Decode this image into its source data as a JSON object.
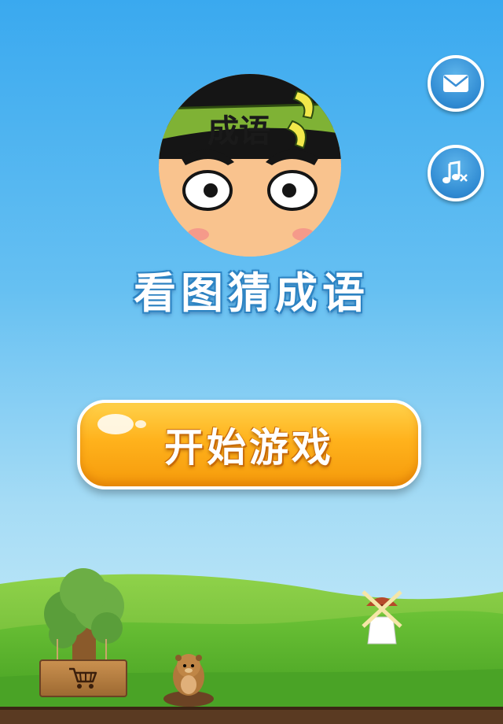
{
  "game": {
    "title": "看图猜成语",
    "headband_text": "成语",
    "start_button_label": "开始游戏"
  },
  "toolbar": {
    "mail_icon": "envelope-icon",
    "music_icon": "music-muted-icon"
  },
  "scene": {
    "shop_icon": "shopping-cart-icon"
  },
  "colors": {
    "sky_top": "#3aa9ef",
    "button_orange": "#ffb21c",
    "grass": "#5cb82e"
  }
}
